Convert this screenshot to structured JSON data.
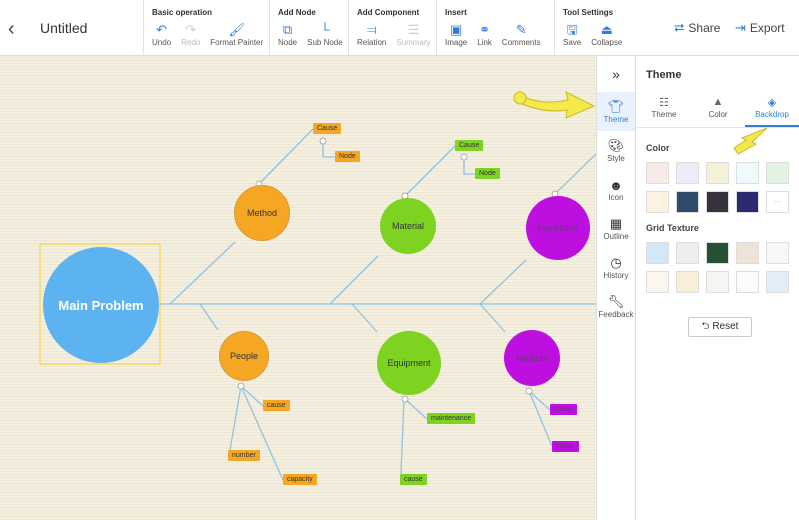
{
  "header": {
    "title": "Untitled",
    "back_icon": "chevron-left-icon",
    "share": "Share",
    "export": "Export"
  },
  "toolbar": {
    "groups": [
      {
        "title": "Basic operation",
        "tools": [
          {
            "label": "Undo",
            "icon": "undo-icon"
          },
          {
            "label": "Redo",
            "icon": "redo-icon",
            "disabled": true
          },
          {
            "label": "Format Painter",
            "icon": "format-painter-icon"
          }
        ]
      },
      {
        "title": "Add Node",
        "tools": [
          {
            "label": "Node",
            "icon": "node-icon"
          },
          {
            "label": "Sub Node",
            "icon": "sub-node-icon"
          }
        ]
      },
      {
        "title": "Add Component",
        "tools": [
          {
            "label": "Relation",
            "icon": "relation-icon"
          },
          {
            "label": "Summary",
            "icon": "summary-icon",
            "disabled": true
          }
        ]
      },
      {
        "title": "Insert",
        "tools": [
          {
            "label": "Image",
            "icon": "image-icon"
          },
          {
            "label": "Link",
            "icon": "link-icon"
          },
          {
            "label": "Comments",
            "icon": "comments-icon"
          }
        ]
      },
      {
        "title": "Tool Settings",
        "tools": [
          {
            "label": "Save",
            "icon": "save-icon"
          },
          {
            "label": "Collapse",
            "icon": "collapse-icon"
          }
        ]
      }
    ]
  },
  "rail": {
    "items": [
      {
        "label": "Theme",
        "active": true
      },
      {
        "label": "Style"
      },
      {
        "label": "Icon"
      },
      {
        "label": "Outline"
      },
      {
        "label": "History"
      },
      {
        "label": "Feedback"
      }
    ]
  },
  "panel": {
    "title": "Theme",
    "tabs": [
      {
        "label": "Theme"
      },
      {
        "label": "Color"
      },
      {
        "label": "Backdrop",
        "active": true
      }
    ],
    "color_title": "Color",
    "colors": [
      "#f7ebe8",
      "#ececf8",
      "#f5f1d6",
      "#eefafb",
      "#e2f4e1",
      "#fdf1e2",
      "#2f4b68",
      "#38323f",
      "#2e2a72",
      "more"
    ],
    "texture_title": "Grid Texture",
    "textures": [
      "#d5e6f7",
      "#eeeeee",
      "#245034",
      "#efe3d8",
      "#f7f7f7",
      "#fbf7ee",
      "#f7efda",
      "#f5f5f1",
      "#fbfbfb",
      "#e1edf7"
    ],
    "reset": "Reset"
  },
  "diagram": {
    "main": "Main Problem",
    "nodes": {
      "method": "Method",
      "material": "Material",
      "inspection": "Inspection",
      "people": "People",
      "equipment": "Equipment",
      "medium": "Medium"
    },
    "labels": {
      "method_cause": "Cause",
      "method_node": "Node",
      "material_cause": "Cause",
      "material_node": "Node",
      "people_cause": "cause",
      "people_number": "number",
      "people_capacity": "capacity",
      "equipment_maintenance": "maintenance",
      "equipment_cause": "cause",
      "medium_cause1": "cause",
      "medium_cause2": "cause"
    },
    "colors": {
      "main": "#5db3ef",
      "orange": "#f5a623",
      "green": "#7ed321",
      "purple": "#bd10e0",
      "line": "#8fc3e6"
    }
  }
}
